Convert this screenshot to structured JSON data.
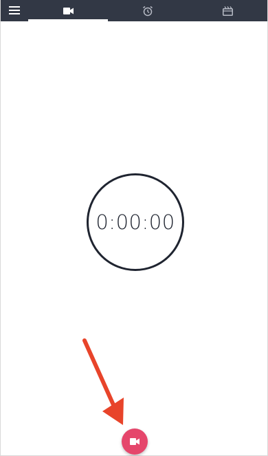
{
  "topbar": {
    "menu_icon": "hamburger-menu-icon",
    "tabs": [
      {
        "icon": "video-camera-icon",
        "active": true
      },
      {
        "icon": "alarm-clock-icon",
        "active": false
      },
      {
        "icon": "timelapse-icon",
        "active": false
      }
    ]
  },
  "timer": {
    "display": "0:00:00"
  },
  "record_button": {
    "icon": "video-camera-icon"
  },
  "colors": {
    "topbar_bg": "#323845",
    "accent": "#e5466b",
    "arrow": "#e8442a"
  }
}
